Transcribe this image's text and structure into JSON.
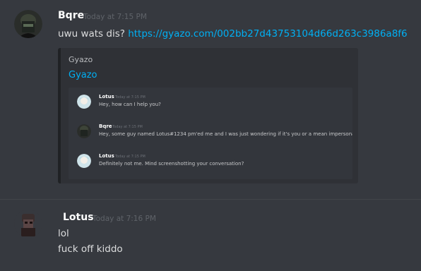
{
  "messages": [
    {
      "username": "Bqre",
      "timestamp": "Today at 7:15 PM",
      "text": "uwu wats dis?",
      "link": "https://gyazo.com/002bb27d43753104d66d263c3986a8f6",
      "embed": {
        "provider": "Gyazo",
        "title": "Gyazo",
        "screenshot_messages": [
          {
            "username": "Lotus",
            "timestamp": "Today at 7:15 PM",
            "text": "Hey, how can I help you?"
          },
          {
            "username": "Bqre",
            "timestamp": "Today at 7:15 PM",
            "text": "Hey, some guy named   Lotus#1234 pm'ed me and I was just wondering if it's you or a mean impersonator."
          },
          {
            "username": "Lotus",
            "timestamp": "Today at 7:15 PM",
            "text": "Definitely not me. Mind screenshotting your conversation?"
          }
        ]
      }
    },
    {
      "username": "Lotus",
      "timestamp": "Today at 7:16 PM",
      "lines": [
        "lol",
        "fuck off kiddo"
      ]
    }
  ],
  "colors": {
    "background": "#36393f",
    "embed_background": "#2f3136",
    "link": "#00b0f4",
    "username": "#ffffff",
    "timestamp": "#5f6369"
  },
  "icons": {
    "bqre_avatar": "dark-hooded-figure-avatar-icon",
    "lotus_avatar": "anime-character-avatar-icon",
    "lotus_dark_avatar": "dark-figure-avatar-icon"
  }
}
